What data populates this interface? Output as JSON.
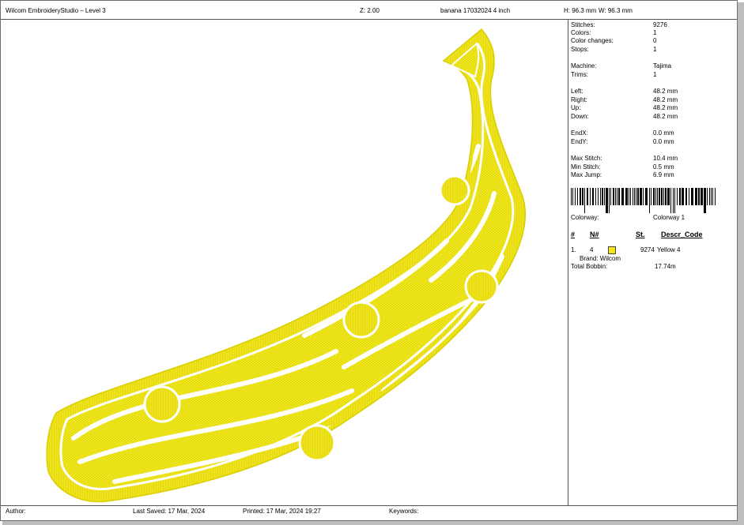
{
  "header": {
    "app_title": "Wilcom EmbroideryStudio – Level 3",
    "zoom": "Z: 2.00",
    "design_name": "banana 17032024 4 inch",
    "height": "H: 96.3 mm",
    "width": "W: 96.3 mm"
  },
  "stats": {
    "stitches_label": "Stitches:",
    "stitches": "9276",
    "colors_label": "Colors:",
    "colors": "1",
    "color_changes_label": "Color changes:",
    "color_changes": "0",
    "stops_label": "Stops:",
    "stops": "1",
    "machine_label": "Machine:",
    "machine": "Tajima",
    "trims_label": "Trims:",
    "trims": "1",
    "left_label": "Left:",
    "left": "48.2 mm",
    "right_label": "Right:",
    "right": "48.2 mm",
    "up_label": "Up:",
    "up": "48.2 mm",
    "down_label": "Down:",
    "down": "48.2 mm",
    "endx_label": "EndX:",
    "endx": "0.0 mm",
    "endy_label": "EndY:",
    "endy": "0.0 mm",
    "max_stitch_label": "Max Stitch:",
    "max_stitch": "10.4 mm",
    "min_stitch_label": "Min Stitch:",
    "min_stitch": "0.5 mm",
    "max_jump_label": "Max Jump:",
    "max_jump": "6.9 mm"
  },
  "colorway": {
    "label": "Colorway:",
    "value": "Colorway 1"
  },
  "thread_table": {
    "headers": [
      "#",
      "N#",
      "St.",
      "Descr_Code"
    ],
    "row": {
      "index": "1.",
      "needle": "4",
      "stitches": "9274",
      "description": "Yellow 4",
      "color": "#f4e41a"
    },
    "brand": "Brand: Wilcom",
    "total_bobbin_label": "Total Bobbin:",
    "total_bobbin": "17.74m"
  },
  "footer": {
    "author": "Author:",
    "last_saved": "Last Saved: 17 Mar, 2024",
    "printed": "Printed: 17 Mar, 2024 19:27",
    "keywords": "Keywords:"
  },
  "design": {
    "thread_color": "#f2ec1c",
    "outline_color": "#e6dc00",
    "background": "#ffffff"
  }
}
